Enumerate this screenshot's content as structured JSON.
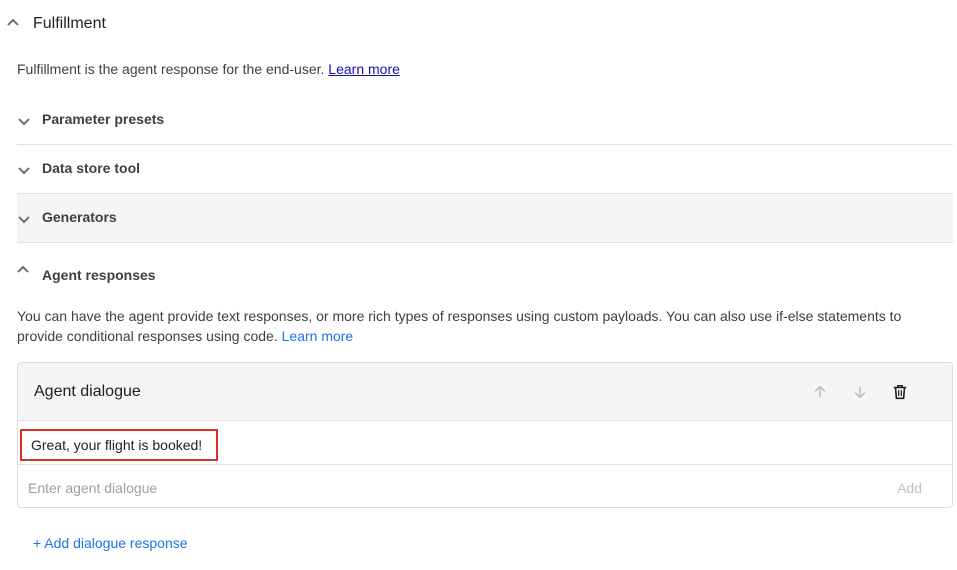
{
  "fulfillment": {
    "title": "Fulfillment",
    "description": "Fulfillment is the agent response for the end-user.",
    "learn_more": "Learn more"
  },
  "sections": [
    {
      "label": "Parameter presets",
      "expanded": false
    },
    {
      "label": "Data store tool",
      "expanded": false
    },
    {
      "label": "Generators",
      "expanded": false
    }
  ],
  "agent_responses": {
    "title": "Agent responses",
    "description": "You can have the agent provide text responses, or more rich types of responses using custom payloads. You can also use if-else statements to provide conditional responses using code.",
    "learn_more": "Learn more",
    "card": {
      "title": "Agent dialogue",
      "response_text": "Great, your flight is booked!",
      "input_placeholder": "Enter agent dialogue",
      "add_label": "Add"
    },
    "add_dialogue_label": "+ Add dialogue response"
  },
  "colors": {
    "link_blue": "#1a73e8",
    "highlight_red": "#d93025"
  },
  "icons": [
    "chevron-up-icon",
    "chevron-down-icon",
    "arrow-up-icon",
    "arrow-down-icon",
    "trash-icon"
  ]
}
